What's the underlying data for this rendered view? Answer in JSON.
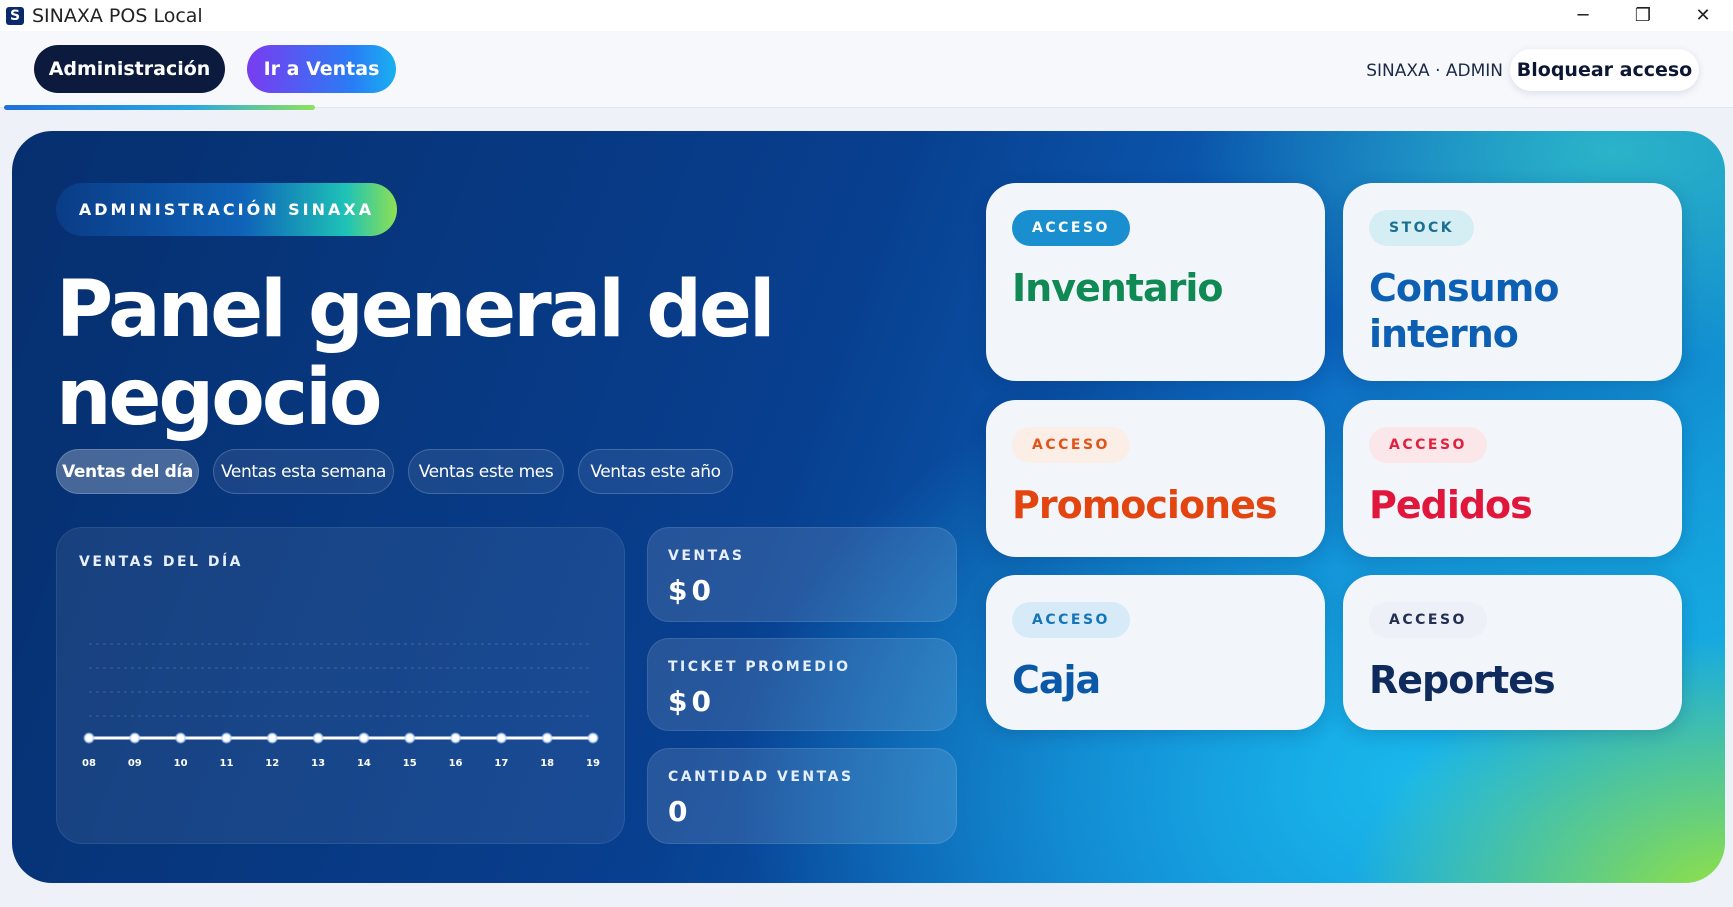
{
  "window": {
    "title": "SINAXA POS Local",
    "logo_letter": "S",
    "minimize": "─",
    "restore": "❐",
    "close": "✕"
  },
  "nav": {
    "admin_label": "Administración",
    "ventas_label": "Ir a Ventas",
    "user_label": "SINAXA · ADMIN",
    "lock_label": "Bloquear acceso"
  },
  "hero": {
    "badge": "ADMINISTRACIÓN SINAXA",
    "title": "Panel general del negocio",
    "ranges": [
      "Ventas del día",
      "Ventas esta semana",
      "Ventas este mes",
      "Ventas este año"
    ],
    "active_range": "Ventas del día"
  },
  "chart": {
    "title": "VENTAS DEL DÍA"
  },
  "chart_data": {
    "type": "line",
    "title": "VENTAS DEL DÍA",
    "categories": [
      "08",
      "09",
      "10",
      "11",
      "12",
      "13",
      "14",
      "15",
      "16",
      "17",
      "18",
      "19"
    ],
    "values": [
      0,
      0,
      0,
      0,
      0,
      0,
      0,
      0,
      0,
      0,
      0,
      0
    ],
    "xlabel": "",
    "ylabel": "",
    "grid": true
  },
  "stats": [
    {
      "label": "VENTAS",
      "value": "$0"
    },
    {
      "label": "TICKET PROMEDIO",
      "value": "$0"
    },
    {
      "label": "CANTIDAD VENTAS",
      "value": "0"
    }
  ],
  "tiles": [
    {
      "badge": "ACCESO",
      "title": "Inventario",
      "badge_bg": "#1a8fd0",
      "badge_color": "#ffffff",
      "title_color": "#108a54"
    },
    {
      "badge": "STOCK",
      "title": "Consumo interno",
      "badge_bg": "#d5eef3",
      "badge_color": "#1a6f92",
      "title_color": "#0c5fb2"
    },
    {
      "badge": "ACCESO",
      "title": "Promociones",
      "badge_bg": "#fbeee6",
      "badge_color": "#e0531b",
      "title_color": "#e2450f"
    },
    {
      "badge": "ACCESO",
      "title": "Pedidos",
      "badge_bg": "#fbe6ea",
      "badge_color": "#e0213f",
      "title_color": "#e0163b"
    },
    {
      "badge": "ACCESO",
      "title": "Caja",
      "badge_bg": "#d6ebf7",
      "badge_color": "#1675b8",
      "title_color": "#0c58a8"
    },
    {
      "badge": "ACCESO",
      "title": "Reportes",
      "badge_bg": "#eef0f8",
      "badge_color": "#233053",
      "title_color": "#0f2a5c"
    }
  ]
}
